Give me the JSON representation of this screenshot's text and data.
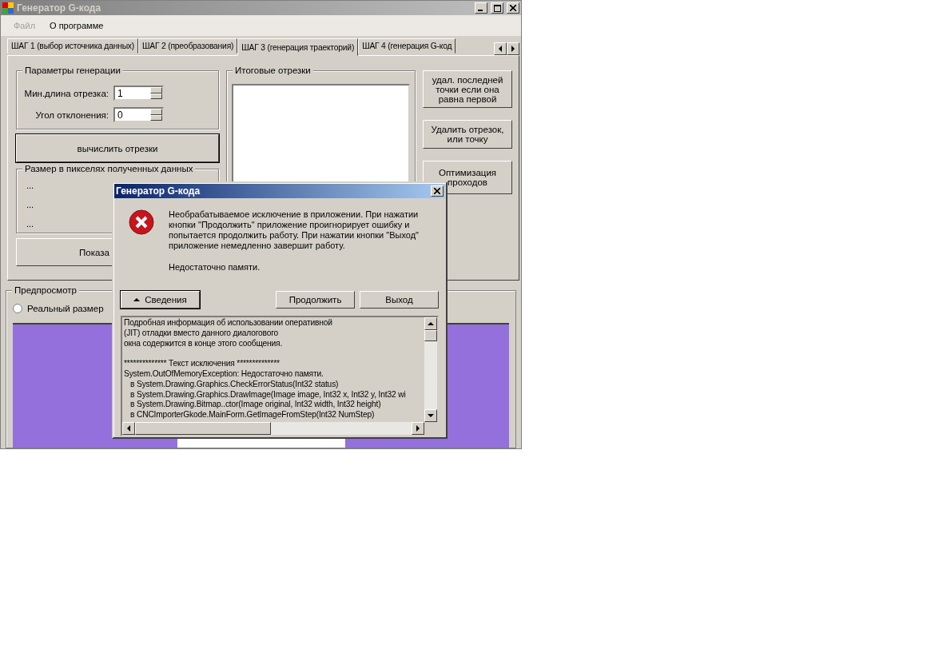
{
  "window": {
    "title": "Генератор G-кода"
  },
  "menu": [
    {
      "label": "Файл",
      "disabled": true
    },
    {
      "label": "О программе",
      "disabled": false
    }
  ],
  "tabs": [
    {
      "label": "ШАГ 1 (выбор источника данных)",
      "selected": false
    },
    {
      "label": "ШАГ 2 (преобразования)",
      "selected": false
    },
    {
      "label": "ШАГ 3 (генерация траекторий)",
      "selected": true
    },
    {
      "label": "ШАГ 4 (генерация G-код",
      "selected": false
    }
  ],
  "params": {
    "title": "Параметры генерации",
    "fields": [
      {
        "label": "Мин.длина отрезка:",
        "value": "1"
      },
      {
        "label": "Угол отклонения:",
        "value": "0"
      }
    ]
  },
  "compute_button": "вычислить отрезки",
  "size_group": {
    "title": "Размер в пикселях полученных данных",
    "lines": [
      "...",
      "...",
      "..."
    ]
  },
  "show_button": "Показа",
  "segments": {
    "title": "Итоговые отрезки"
  },
  "side_buttons": [
    "удал. последней точки если она равна первой",
    "Удалить отрезок, или точку",
    "Оптимизация проходов"
  ],
  "preview": {
    "title": "Предпросмотр",
    "radio": {
      "label": "Реальный размер",
      "checked": false
    }
  },
  "dialog": {
    "title": "Генератор G-кода",
    "message": "Необрабатываемое исключение в приложении. При нажатии кнопки \"Продолжить\" приложение проигнорирует ошибку и попытается продолжить работу. При нажатии кнопки \"Выход\" приложение немедленно завершит работу.",
    "error": "Недостаточно памяти.",
    "details_button": {
      "label": "Сведения",
      "expanded": true
    },
    "buttons": [
      "Продолжить",
      "Выход"
    ],
    "details": [
      [
        "Подробная информация об использовании оперативной",
        "(JIT) отладки вместо данного диалогового",
        "окна содержится в конце этого сообщения."
      ],
      [
        "************** Текст исключения **************",
        "System.OutOfMemoryException: Недостаточно памяти.",
        "   в System.Drawing.Graphics.CheckErrorStatus(Int32 status)",
        "   в System.Drawing.Graphics.DrawImage(Image image, Int32 x, Int32 y, Int32 wi",
        "   в System.Drawing.Bitmap..ctor(Image original, Int32 width, Int32 height)",
        "   в CNCImporterGkode.MainForm.GetImageFromStep(Int32 NumStep)"
      ]
    ]
  }
}
